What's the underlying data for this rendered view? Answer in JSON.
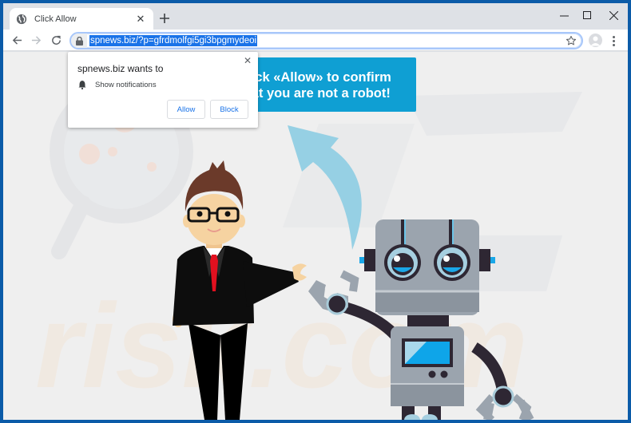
{
  "browser": {
    "tab": {
      "title": "Click Allow",
      "favicon": "globe-icon",
      "close_icon": "close-icon"
    },
    "new_tab_icon": "plus-icon",
    "window_controls": {
      "minimize": "minimize-icon",
      "maximize": "maximize-icon",
      "close": "close-icon"
    },
    "toolbar": {
      "back": "back-arrow-icon",
      "forward": "forward-arrow-icon",
      "reload": "reload-icon",
      "url": "spnews.biz/?p=gfrdmolfgi5gi3bpgmydeoi",
      "url_selected": true,
      "security_icon": "lock-icon",
      "bookmark_icon": "star-icon",
      "profile_icon": "profile-avatar-icon",
      "menu_icon": "kebab-menu-icon"
    }
  },
  "notification_popup": {
    "title": "spnews.biz wants to",
    "permission_icon": "bell-icon",
    "permission": "Show notifications",
    "allow_label": "Allow",
    "block_label": "Block",
    "close_icon": "close-icon"
  },
  "page": {
    "banner_line1": "Click «Allow» to confirm",
    "banner_line2": "that you are not a robot!",
    "colors": {
      "banner": "#0f9fd3",
      "arrow": "#8ecde3",
      "robot_body": "#9ba4ae",
      "robot_dark": "#2e2733",
      "robot_screen": "#0ea5e9",
      "suit": "#0d0d0d",
      "tie": "#e2101f",
      "hair": "#6b3a2a",
      "skin": "#f6d3a1"
    },
    "illustration": {
      "man": "businessman pointing",
      "arrow": "curved arrow pointing up",
      "robot": "robot with wrench claws"
    },
    "watermark": "pcrisk.com"
  }
}
